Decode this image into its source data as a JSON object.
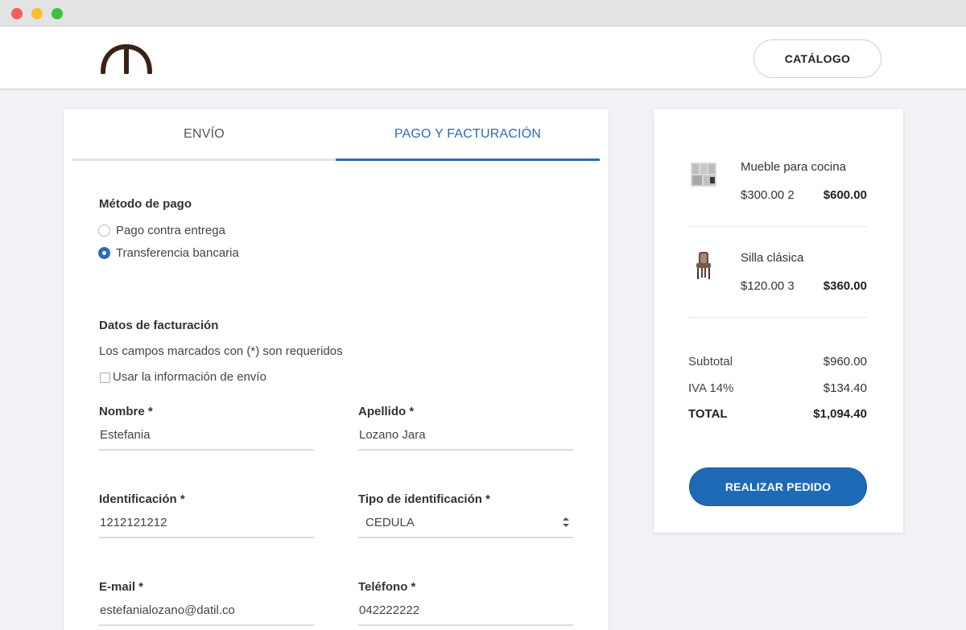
{
  "header": {
    "catalog_label": "CATÁLOGO"
  },
  "tabs": [
    {
      "label": "ENVÍO"
    },
    {
      "label": "PAGO Y FACTURACIÓN"
    }
  ],
  "payment": {
    "title": "Método de pago",
    "options": [
      {
        "label": "Pago contra entrega",
        "selected": false
      },
      {
        "label": "Transferencia bancaria",
        "selected": true
      }
    ]
  },
  "billing": {
    "title": "Datos de facturación",
    "required_note": "Los campos marcados con (*) son requeridos",
    "use_shipping_label": "Usar la información de envío",
    "fields": {
      "nombre": {
        "label": "Nombre *",
        "value": "Estefania"
      },
      "apellido": {
        "label": "Apellido *",
        "value": "Lozano Jara"
      },
      "identificacion": {
        "label": "Identificación *",
        "value": "1212121212"
      },
      "tipo_id": {
        "label": "Tipo de identificación *",
        "value": "CEDULA"
      },
      "email": {
        "label": "E-mail *",
        "value": "estefanialozano@datil.co"
      },
      "telefono": {
        "label": "Teléfono *",
        "value": "042222222"
      }
    }
  },
  "cart": {
    "items": [
      {
        "name": "Mueble para cocina",
        "price": "$300.00",
        "qty": "2",
        "total": "$600.00",
        "icon": "kitchen-cabinet"
      },
      {
        "name": "Silla clásica",
        "price": "$120.00",
        "qty": "3",
        "total": "$360.00",
        "icon": "chair"
      }
    ],
    "subtotal_label": "Subtotal",
    "subtotal": "$960.00",
    "tax_label": "IVA 14%",
    "tax": "$134.40",
    "total_label": "TOTAL",
    "total": "$1,094.40",
    "order_button": "REALIZAR PEDIDO"
  },
  "colors": {
    "accent": "#2c6cb0",
    "button": "#1f6ab6",
    "logo": "#3a2218"
  }
}
